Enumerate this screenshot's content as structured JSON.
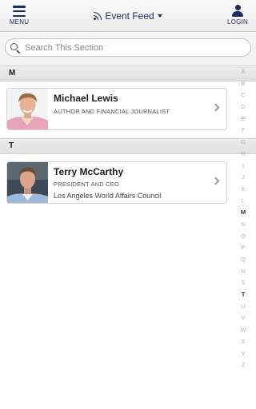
{
  "header": {
    "menu_label": "MENU",
    "login_label": "LOGIN",
    "title": "Event Feed",
    "icons": {
      "menu": "hamburger-icon",
      "title": "rss-icon",
      "title_dropdown": "caret-down-icon",
      "login": "person-icon"
    }
  },
  "search": {
    "placeholder": "Search This Section",
    "value": "",
    "icon": "search-icon"
  },
  "sections": [
    {
      "letter": "M"
    },
    {
      "letter": "T"
    }
  ],
  "people": [
    {
      "name": "Michael Lewis",
      "title": "AUTHOR AND FINANCIAL JOURNALIST",
      "organization": ""
    },
    {
      "name": "Terry McCarthy",
      "title": "PRESIDENT AND CEO",
      "organization": "Los Angeles World Affairs Council"
    }
  ],
  "alphabet_index": [
    "A",
    "B",
    "C",
    "D",
    "E",
    "F",
    "G",
    "H",
    "I",
    "J",
    "K",
    "L",
    "M",
    "N",
    "O",
    "P",
    "Q",
    "R",
    "S",
    "T",
    "U",
    "V",
    "W",
    "X",
    "Y",
    "Z"
  ],
  "alphabet_active": [
    "M",
    "T"
  ],
  "colors": {
    "brand": "#1f2d5c",
    "section_bg": "#e6e6e6",
    "index_inactive": "#b3b3b3",
    "index_active": "#333333"
  }
}
